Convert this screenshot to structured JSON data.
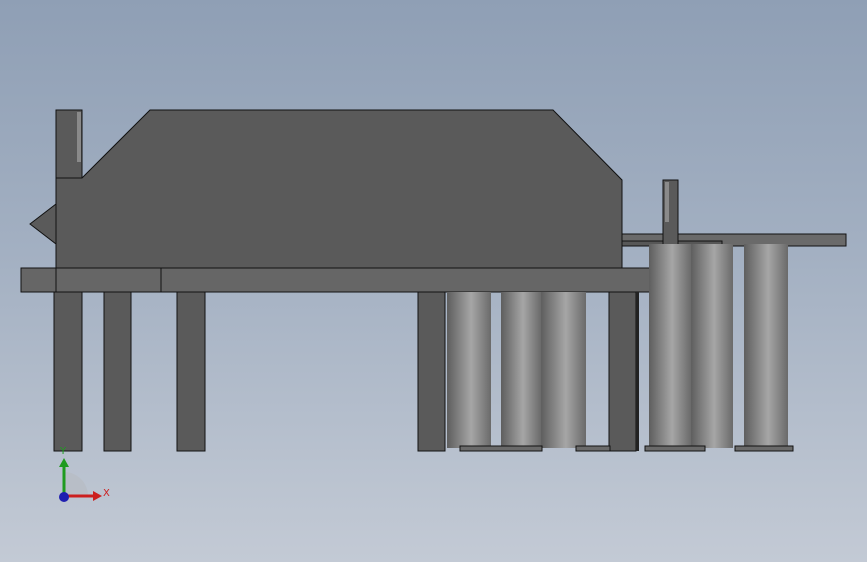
{
  "viewport": {
    "background_top": "#8f9fb5",
    "background_bottom": "#c3cad5"
  },
  "model": {
    "body_color": "#5a5a5a",
    "edge_color": "#111111",
    "roller_light": "#a6a6a6",
    "roller_dark": "#5e5e5e"
  },
  "triad": {
    "x_label": "X",
    "y_label": "Y",
    "x_color": "#cc1f1f",
    "y_color": "#1f9b1f",
    "z_color": "#1f1fb0"
  }
}
